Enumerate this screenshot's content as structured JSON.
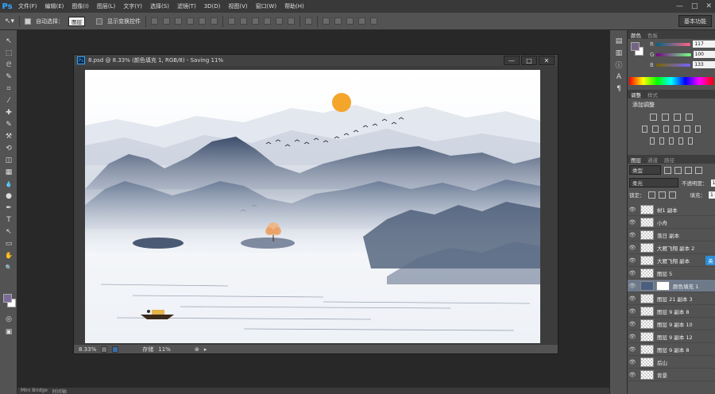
{
  "menubar": {
    "logo": "Ps",
    "items": [
      "文件(F)",
      "编辑(E)",
      "图像(I)",
      "图层(L)",
      "文字(Y)",
      "选择(S)",
      "滤镜(T)",
      "3D(D)",
      "视图(V)",
      "窗口(W)",
      "帮助(H)"
    ],
    "win_ctrls": [
      "—",
      "□",
      "✕"
    ]
  },
  "options": {
    "auto_select_label": "自动选择：",
    "auto_select_value": "图层",
    "transform_label": "显示变换控件",
    "workspace": "基本功能"
  },
  "tools": {
    "icons": [
      "move-icon",
      "marquee-icon",
      "lasso-icon",
      "quick-select-icon",
      "crop-icon",
      "eyedropper-icon",
      "spot-heal-icon",
      "brush-icon",
      "clone-stamp-icon",
      "history-brush-icon",
      "eraser-icon",
      "gradient-icon",
      "blur-icon",
      "dodge-icon",
      "pen-icon",
      "type-icon",
      "path-select-icon",
      "rectangle-icon",
      "hand-icon",
      "zoom-icon"
    ],
    "glyphs": [
      "↖",
      "⬚",
      "ᘓ",
      "✎",
      "⌗",
      "⁄",
      "✚",
      "✎",
      "⚒",
      "⟲",
      "◫",
      "▦",
      "💧",
      "●",
      "✒",
      "T",
      "↖",
      "▭",
      "✋",
      "🔍"
    ],
    "fg_color": "#7a6a9a",
    "bg_color": "#ffffff"
  },
  "document": {
    "title": "8.psd @ 8.33% (颜色填充 1, RGB/8) - Saving 11%",
    "zoom": "8.33%",
    "save_label": "存储",
    "save_progress": "11%"
  },
  "color_panel": {
    "tabs": [
      "颜色",
      "色板"
    ],
    "r_label": "R",
    "r_value": "117",
    "g_label": "G",
    "g_value": "100",
    "b_label": "B",
    "b_value": "133",
    "fg_color": "#756485"
  },
  "adjust_panel": {
    "tabs": [
      "调整",
      "样式"
    ],
    "heading": "添加调整"
  },
  "layers_panel": {
    "tabs": [
      "图层",
      "通道",
      "路径"
    ],
    "filter_label": "类型",
    "blend_mode": "柔光",
    "opacity_label": "不透明度：",
    "opacity_value": "1",
    "lock_label": "锁定：",
    "fill_label": "填充：",
    "fill_value": "1",
    "ime_badge": "英",
    "layers": [
      {
        "name": "树1 副本"
      },
      {
        "name": "小舟"
      },
      {
        "name": "落日 副本"
      },
      {
        "name": "大雁飞翔 副本 2"
      },
      {
        "name": "大雁飞翔 副本"
      },
      {
        "name": "图层 5"
      },
      {
        "name": "颜色填充 1",
        "selected": true
      },
      {
        "name": "图层 21 副本 3"
      },
      {
        "name": "图层 9 副本 8"
      },
      {
        "name": "图层 9 副本 10"
      },
      {
        "name": "图层 9 副本 12"
      },
      {
        "name": "图层 9 副本 8"
      },
      {
        "name": "后山"
      },
      {
        "name": "背景"
      }
    ]
  },
  "bottom": {
    "items": [
      "Mini Bridge",
      "时间轴"
    ]
  }
}
